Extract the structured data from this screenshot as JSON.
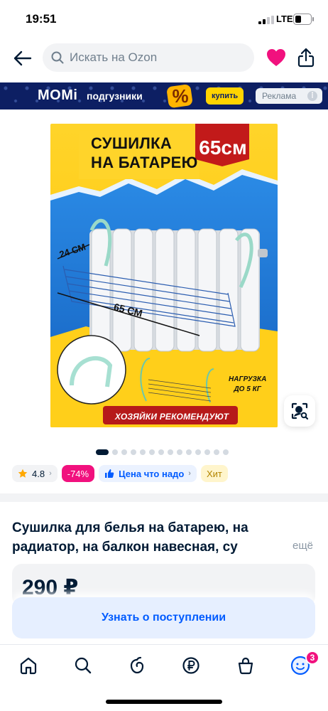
{
  "status_bar": {
    "time": "19:51",
    "network": "LTE"
  },
  "header": {
    "search_placeholder": "Искать на Ozon",
    "icons": [
      "back-arrow-icon",
      "search-icon",
      "heart-icon",
      "share-icon"
    ],
    "heart_color": "#f1117e"
  },
  "ad_banner": {
    "brand": "MOMi",
    "subtitle": "подгузники",
    "button_label": "купить",
    "badge_label": "Реклама",
    "kebab": "⋮"
  },
  "product_image": {
    "title_line1": "СУШИЛКА",
    "title_line2": "НА БАТАРЕЮ",
    "size_badge": "65см",
    "dimension_depth": "24 СМ",
    "dimension_width": "65 СМ",
    "load_line1": "НАГРУЗКА",
    "load_line2": "ДО 5 КГ",
    "recommendation": "ХОЗЯЙКИ РЕКОМЕНДУЮТ"
  },
  "gallery": {
    "total_images": 14,
    "active_index": 0
  },
  "chips": {
    "rating": "4.8",
    "rating_arrow": "›",
    "discount": "-74%",
    "price_label": "Цена что надо",
    "price_arrow": "›",
    "hit": "Хит"
  },
  "product": {
    "title": "Сушилка для белья на батарею, на радиатор, на балкон навесная, су",
    "more_label": "ещё",
    "price": "290 ₽",
    "notify_button": "Узнать о поступлении"
  },
  "tabbar": {
    "tabs": [
      "home-icon",
      "search-icon",
      "fresh-icon",
      "finance-icon",
      "cart-icon",
      "profile-icon"
    ],
    "profile_badge": "3"
  },
  "colors": {
    "accent": "#005bff",
    "pink": "#f1117e",
    "text": "#001a34",
    "ad_bg": "#0d1f63"
  }
}
